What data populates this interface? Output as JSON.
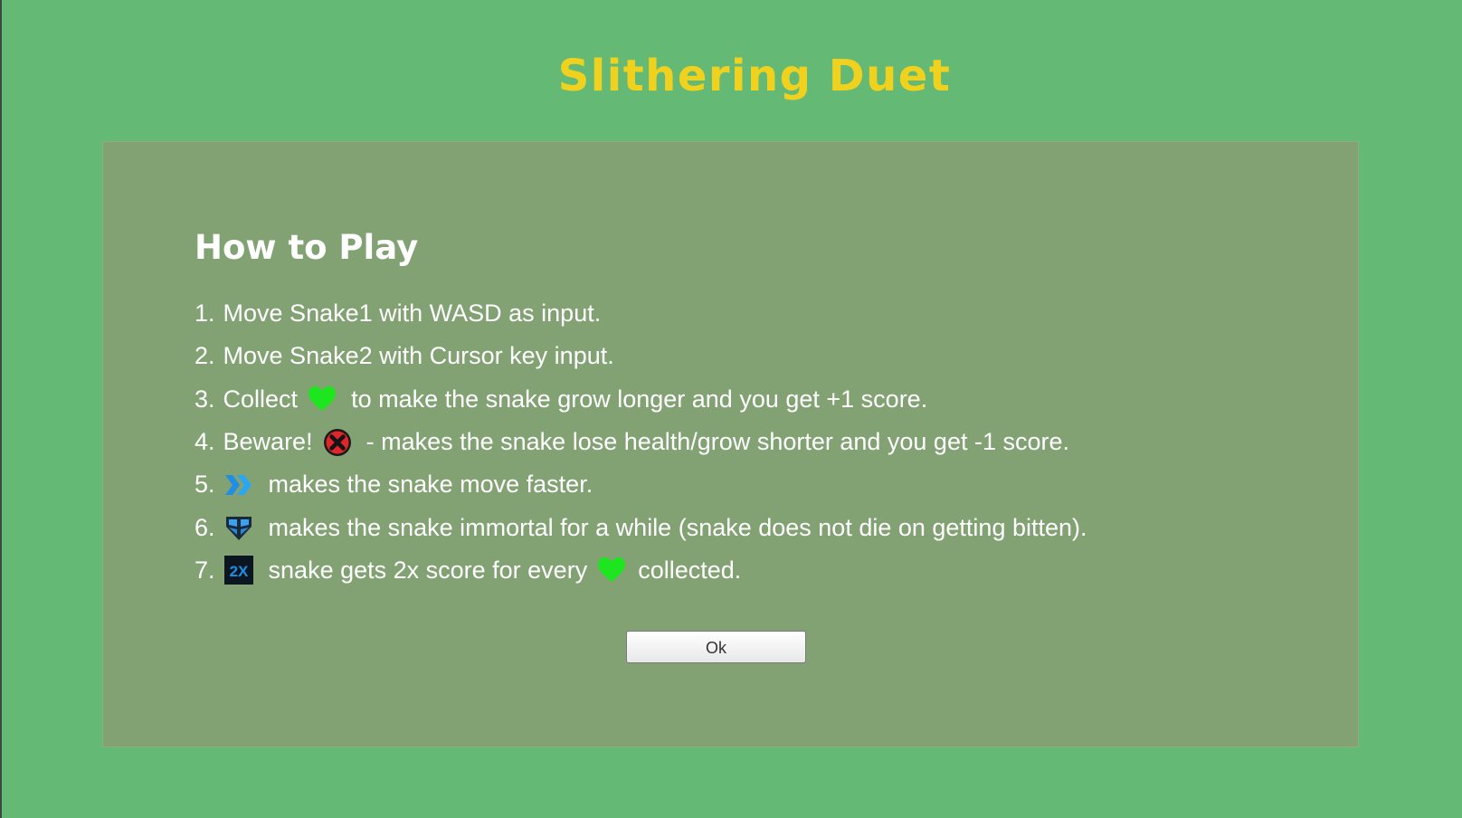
{
  "title": "Slithering Duet",
  "panel": {
    "heading": "How to Play",
    "ok_label": "Ok",
    "rules": {
      "r1": {
        "num": "1.",
        "text": "Move Snake1 with WASD as input."
      },
      "r2": {
        "num": "2.",
        "text": "Move Snake2 with Cursor key input."
      },
      "r3": {
        "num": "3.",
        "before": "Collect",
        "after": "to make the snake grow longer and you get +1 score.",
        "icon": "heart-icon"
      },
      "r4": {
        "num": "4.",
        "before": "Beware!",
        "after": "- makes the snake lose health/grow shorter and you get -1 score.",
        "icon": "red-x-icon"
      },
      "r5": {
        "num": "5.",
        "after": "makes the snake move faster.",
        "icon": "speed-arrows-icon"
      },
      "r6": {
        "num": "6.",
        "after": "makes the snake immortal for a while (snake does not die on getting bitten).",
        "icon": "shield-icon"
      },
      "r7": {
        "num": "7.",
        "middle": "snake gets 2x score for every",
        "after": "collected.",
        "icon": "double-score-icon",
        "icon2": "heart-icon",
        "badge_text": "2X"
      }
    }
  },
  "colors": {
    "background": "#64b975",
    "panel": "#82a274",
    "title": "#f0d21e",
    "text": "#ffffff",
    "heart": "#1ee61e",
    "speed": "#1e96f0"
  }
}
